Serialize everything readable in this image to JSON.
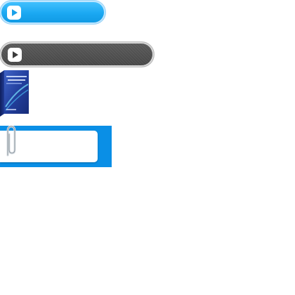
{
  "buttons": {
    "blue_play": {
      "icon": "play-icon",
      "color": "#1aa8f2"
    },
    "dark_play": {
      "icon": "play-icon",
      "color": "#4f4f4f"
    }
  },
  "software_box": {
    "icon": "software-box-image"
  },
  "clip_panel": {
    "icon": "paperclip-icon",
    "background": "#0a8fe6",
    "value": ""
  }
}
